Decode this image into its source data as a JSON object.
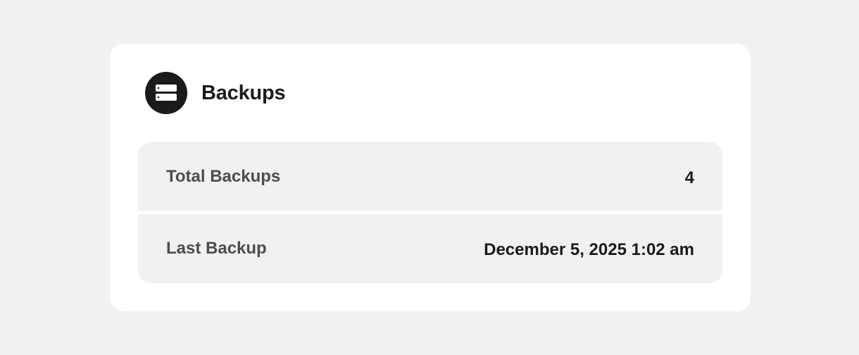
{
  "card": {
    "title": "Backups",
    "icon": "server-stack-icon"
  },
  "stats": [
    {
      "label": "Total Backups",
      "value": "4"
    },
    {
      "label": "Last Backup",
      "value": "December 5, 2025 1:02 am"
    }
  ],
  "colors": {
    "page_background": "#f1f1f1",
    "card_background": "#ffffff",
    "icon_background": "#1b1b1b",
    "title_text": "#1b1b1b",
    "label_text": "#4d4d4d"
  }
}
